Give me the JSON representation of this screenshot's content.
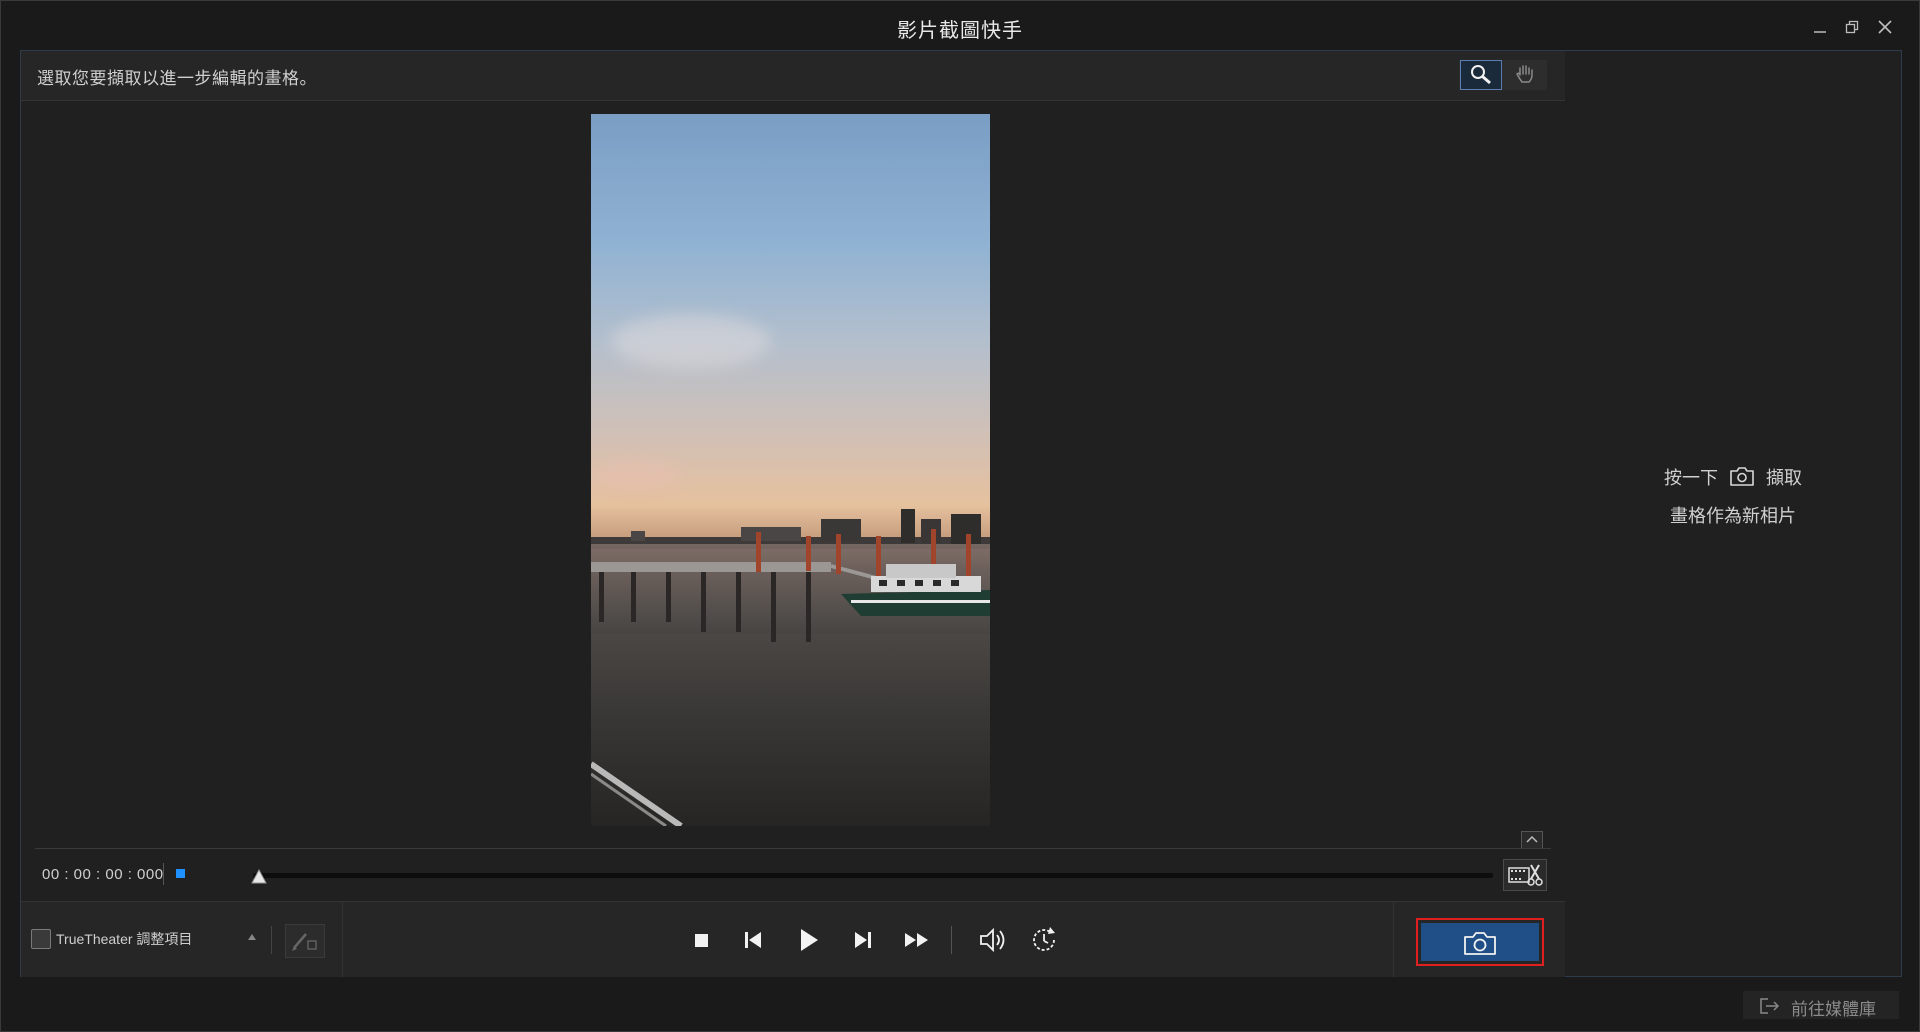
{
  "window": {
    "title": "影片截圖快手",
    "minimize_icon": "minimize-icon",
    "restore_icon": "restore-icon",
    "close_icon": "close-icon"
  },
  "hint": {
    "text": "選取您要擷取以進一步編輯的畫格。"
  },
  "tools": {
    "zoom_icon": "zoom-magnifier-icon",
    "hand_icon": "hand-pan-icon"
  },
  "timeline": {
    "timecode": "00 : 00 : 00 : 000",
    "position": 0
  },
  "controls": {
    "truetheater_label": "TrueTheater 調整項目",
    "truetheater_checked": false,
    "buttons": [
      "stop-icon",
      "previous-frame-icon",
      "play-icon",
      "next-frame-icon",
      "fast-forward-icon",
      "volume-icon",
      "timer-icon"
    ]
  },
  "capture": {
    "icon": "camera-icon",
    "highlight_color": "#e02020",
    "button_color": "#1f4f86"
  },
  "right_panel": {
    "line1_prefix": "按一下",
    "line1_suffix": "擷取",
    "line2": "畫格作為新相片"
  },
  "library_button": {
    "label": "前往媒體庫"
  }
}
